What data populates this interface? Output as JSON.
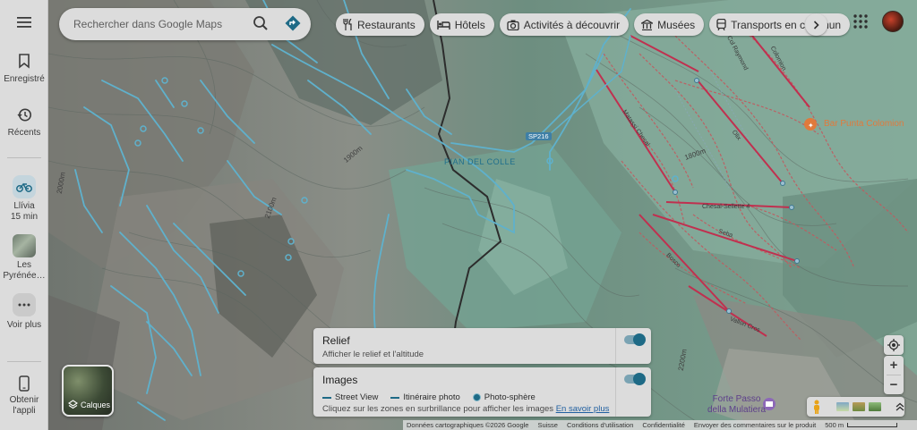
{
  "sidebar": {
    "menu_icon": "hamburger-menu-icon",
    "items": [
      {
        "label": "Enregistré",
        "icon": "bookmark-icon"
      },
      {
        "label": "Récents",
        "icon": "history-icon"
      },
      {
        "label": "Llívia",
        "sublabel": "15 min",
        "icon": "bicycle-icon"
      },
      {
        "label": "Les Pyrénée…",
        "icon": "place-thumbnail"
      },
      {
        "label": "Voir plus",
        "icon": "more-dots-icon"
      },
      {
        "label": "Obtenir l'appli",
        "icon": "phone-icon"
      }
    ]
  },
  "search": {
    "placeholder": "Rechercher dans Google Maps",
    "search_icon": "search-icon",
    "directions_icon": "directions-icon"
  },
  "chips": [
    {
      "label": "Restaurants",
      "icon": "fork-knife-icon"
    },
    {
      "label": "Hôtels",
      "icon": "bed-icon"
    },
    {
      "label": "Activités à découvrir",
      "icon": "camera-icon"
    },
    {
      "label": "Musées",
      "icon": "museum-icon"
    },
    {
      "label": "Transports en commun",
      "icon": "train-icon"
    }
  ],
  "map_labels": {
    "place": "PIAN DEL COLLE",
    "road": "SP216",
    "poi_bar": "Bar Punta Colomion",
    "poi_fort_1": "Forte Passo",
    "poi_fort_2": "della Mulatiera",
    "piste_1": "Matassi Chesal",
    "piste_2": "Chesal-Sellette 4",
    "piste_3": "Seba",
    "piste_4": "Bosco",
    "piste_5": "Vallon Cros",
    "piste_6": "Olix",
    "piste_7": "Col Raymond",
    "piste_8": "Colomion",
    "contour_1": "2000m",
    "contour_2": "2100m",
    "contour_3": "1900m",
    "contour_4": "1800m",
    "contour_5": "2200m"
  },
  "layers": {
    "relief": {
      "title": "Relief",
      "description": "Afficher le relief et l'altitude",
      "enabled": true
    },
    "images": {
      "title": "Images",
      "legend": [
        "Street View",
        "Itinéraire photo",
        "Photo-sphère"
      ],
      "description": "Cliquez sur les zones en surbrillance pour afficher les images",
      "link": "En savoir plus",
      "enabled": true
    }
  },
  "calques": {
    "label": "Calques"
  },
  "footer": {
    "data": "Données cartographiques ©2026 Google",
    "country": "Suisse",
    "terms": "Conditions d'utilisation",
    "privacy": "Confidentialité",
    "feedback": "Envoyer des commentaires sur le produit",
    "scale": "500 m"
  },
  "controls": {
    "location_icon": "my-location-icon",
    "zoom_in": "+",
    "zoom_out": "−",
    "pegman_icon": "pegman-icon",
    "expand_icon": "chevron-up-icon"
  },
  "colors": {
    "water": "#5fb1cc",
    "piste": "#c0304f",
    "piste_dashed": "#c25a5f",
    "accent": "#1e6a86"
  }
}
